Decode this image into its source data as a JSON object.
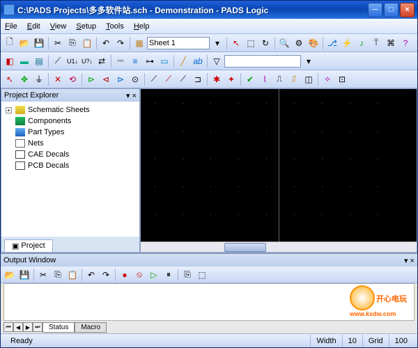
{
  "title": "C:\\PADS Projects\\多多软件站.sch - Demonstration - PADS Logic",
  "menu": {
    "file": "File",
    "edit": "Edit",
    "view": "View",
    "setup": "Setup",
    "tools": "Tools",
    "help": "Help"
  },
  "sheetSelector": "Sheet 1",
  "explorer": {
    "title": "Project Explorer",
    "items": [
      {
        "label": "Schematic Sheets",
        "icon": "ti-sheets",
        "expandable": true
      },
      {
        "label": "Components",
        "icon": "ti-comp"
      },
      {
        "label": "Part Types",
        "icon": "ti-part"
      },
      {
        "label": "Nets",
        "icon": "ti-nets"
      },
      {
        "label": "CAE Decals",
        "icon": "ti-cae"
      },
      {
        "label": "PCB Decals",
        "icon": "ti-pcb"
      }
    ],
    "tab": "Project"
  },
  "output": {
    "title": "Output Window",
    "tabs": {
      "status": "Status",
      "macro": "Macro"
    }
  },
  "status": {
    "ready": "Ready",
    "widthLabel": "Width",
    "widthValue": "10",
    "gridLabel": "Grid",
    "gridValue": "100"
  },
  "watermark": {
    "text": "开心电玩",
    "url": "www.kxdw.com"
  }
}
